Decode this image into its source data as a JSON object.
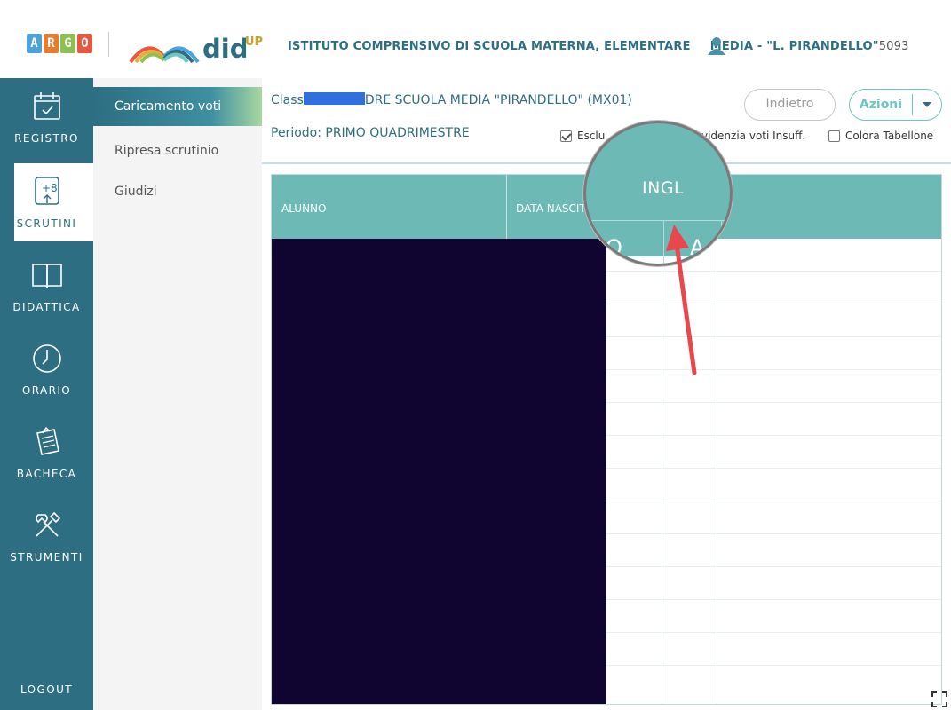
{
  "header": {
    "argo_letters": [
      "A",
      "R",
      "G",
      "O"
    ],
    "argo_colors": [
      "#4aa3df",
      "#e57c2f",
      "#8cc152",
      "#e9573f"
    ],
    "logo_text": "did",
    "logo_sup": "UP",
    "school_title": "ISTITUTO COMPRENSIVO DI SCUOLA MATERNA, ELEMENTARE",
    "school_title_tail": "MEDIA - \"L. PIRANDELLO\"",
    "school_code": "5093"
  },
  "rail": {
    "items": [
      {
        "label": "REGISTRO",
        "icon": "calendar-check-icon"
      },
      {
        "label": "SCRUTINI",
        "icon": "scrutini-plus8-icon"
      },
      {
        "label": "DIDATTICA",
        "icon": "open-book-icon"
      },
      {
        "label": "ORARIO",
        "icon": "clock-icon"
      },
      {
        "label": "BACHECA",
        "icon": "notice-board-icon"
      },
      {
        "label": "STRUMENTI",
        "icon": "tools-icon"
      }
    ],
    "logout": "LOGOUT"
  },
  "submenu": {
    "items": [
      "Caricamento voti",
      "Ripresa scrutinio",
      "Giudizi"
    ]
  },
  "main": {
    "class_prefix": "Class",
    "class_suffix": "DRE SCUOLA MEDIA \"PIRANDELLO\" (MX01)",
    "periodo": "Periodo: PRIMO QUADRIMESTRE",
    "back_button": "Indietro",
    "actions_button": "Azioni",
    "options": [
      {
        "label": "Esclu",
        "checked": true
      },
      {
        "label": "videnzia voti Insuff.",
        "checked": false
      },
      {
        "label": "Colora Tabellone",
        "checked": false
      }
    ]
  },
  "table": {
    "col_alunno": "ALUNNO",
    "col_data": "DATA NASCIT",
    "magnified_header": "INGL",
    "magnified_sub1": "O",
    "magnified_sub2": "A"
  },
  "colors": {
    "rail": "#2d6e82",
    "table_header": "#6cb9b6",
    "accent": "#6ec6c0",
    "arrow": "#e8474c"
  }
}
